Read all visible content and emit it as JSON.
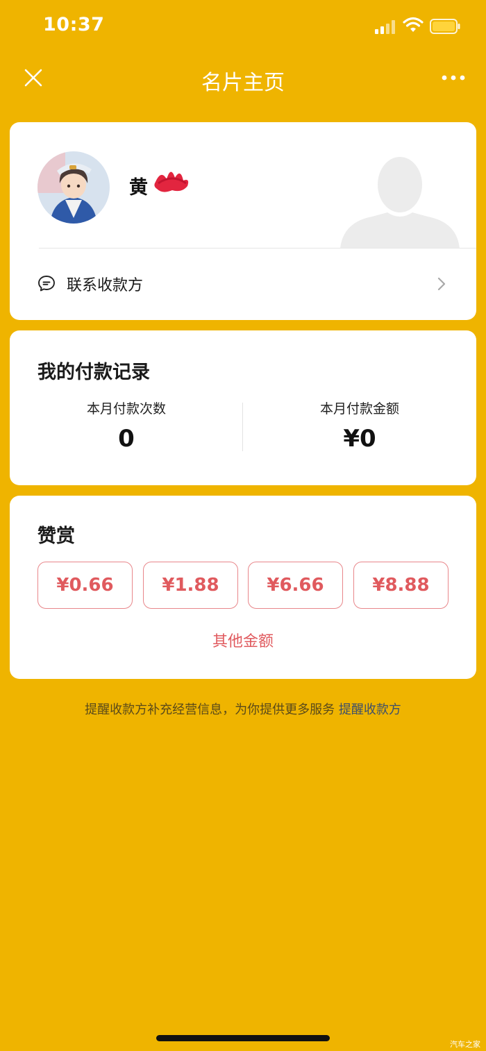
{
  "status_bar": {
    "time": "10:37"
  },
  "nav": {
    "title": "名片主页"
  },
  "profile": {
    "name": "黄",
    "contact_label": "联系收款方"
  },
  "records": {
    "title": "我的付款记录",
    "count_label": "本月付款次数",
    "count_value": "0",
    "amount_label": "本月付款金额",
    "amount_value": "¥0"
  },
  "reward": {
    "title": "赞赏",
    "amounts": [
      "¥0.66",
      "¥1.88",
      "¥6.66",
      "¥8.88"
    ],
    "other_label": "其他金额"
  },
  "footer": {
    "text": "提醒收款方补充经营信息，为你提供更多服务 ",
    "link": "提醒收款方"
  },
  "watermark": "汽车之家",
  "colors": {
    "background": "#EFB400",
    "accent_red": "#E05A5E",
    "link": "#3d4f6a"
  }
}
